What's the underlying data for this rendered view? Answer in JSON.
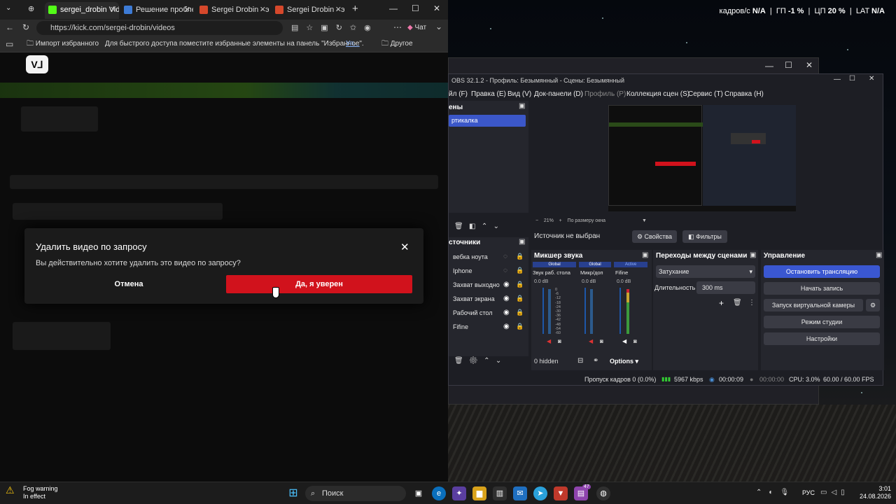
{
  "overlay": {
    "fps_label": "кадров/с",
    "fps_value": "N/A",
    "gpu_label": "ГП",
    "gpu_value": "-1 %",
    "cpu_label": "ЦП",
    "cpu_value": "20 %",
    "lat_label": "LAT",
    "lat_value": "N/A"
  },
  "browser": {
    "tabs": [
      "sergei_drobin Video",
      "Решение проблем",
      "Sergei Drobin - экс",
      "Sergei Drobin - экс"
    ],
    "url": "https://kick.com/sergei-drobin/videos",
    "chat_label": "Чат",
    "bookmarks": {
      "import": "Импорт избранного",
      "hint": "Для быстрого доступа поместите избранные элементы на панель \"Избранное\".",
      "hint_link": "Уп...",
      "other": "Другое избранное"
    }
  },
  "dialog": {
    "title": "Удалить видео по запросу",
    "text": "Вы действительно хотите удалить это видео по запросу?",
    "cancel": "Отмена",
    "confirm": "Да, я уверен"
  },
  "obs": {
    "title": "OBS 32.1.2 - Профиль: Безымянный - Сцены: Безымянный",
    "menu": [
      "йл (F)",
      "Правка (E)",
      "Вид (V)",
      "Док-панели (D)",
      "Профиль (P)",
      "Коллекция сцен (S)",
      "Сервис (T)",
      "Справка (H)"
    ],
    "scenes_header": "ены",
    "scene_selected": "ртикалка",
    "preview_zoom": "21%",
    "preview_fit": "По размеру окна",
    "no_source": "Источник не выбран",
    "properties": "Свойства",
    "filters": "Фильтры",
    "sources_header": "сточники",
    "sources": [
      "вебка ноута",
      "Iphone",
      "Захват выходно",
      "Захват экрана",
      "Рабочий стол",
      "Fifine"
    ],
    "mixer_header": "Микшер звука",
    "mixer_tags": [
      "Global",
      "Global",
      "Active"
    ],
    "mixer_channels": [
      "Звук раб. стола",
      "Микр/доп",
      "Fifine"
    ],
    "mixer_db": [
      "0.0 dB",
      "0.0 dB",
      "0.0 dB"
    ],
    "meter_ticks": [
      "0",
      "-6",
      "-12",
      "-18",
      "-24",
      "-30",
      "-36",
      "-42",
      "-48",
      "-54",
      "-60"
    ],
    "hidden_label": "0 hidden",
    "options_label": "Options",
    "transitions_header": "Переходы между сценами",
    "transition_value": "Затухание",
    "duration_label": "Длительность",
    "duration_value": "300 ms",
    "controls_header": "Управление",
    "controls": [
      "Остановить трансляцию",
      "Начать запись",
      "Запуск виртуальной камеры",
      "Режим студии",
      "Настройки"
    ],
    "status": {
      "dropped": "Пропуск кадров 0 (0.0%)",
      "bitrate": "5967 kbps",
      "stream_time": "00:00:09",
      "rec_time": "00:00:00",
      "cpu": "CPU: 3.0%",
      "fps": "60.00 / 60.00 FPS"
    }
  },
  "taskbar": {
    "weather_title": "Fog warning",
    "weather_sub": "In effect",
    "search": "Поиск",
    "lang": "РУС",
    "time": "3:01",
    "date": "24.08.2026",
    "badge": "47"
  }
}
